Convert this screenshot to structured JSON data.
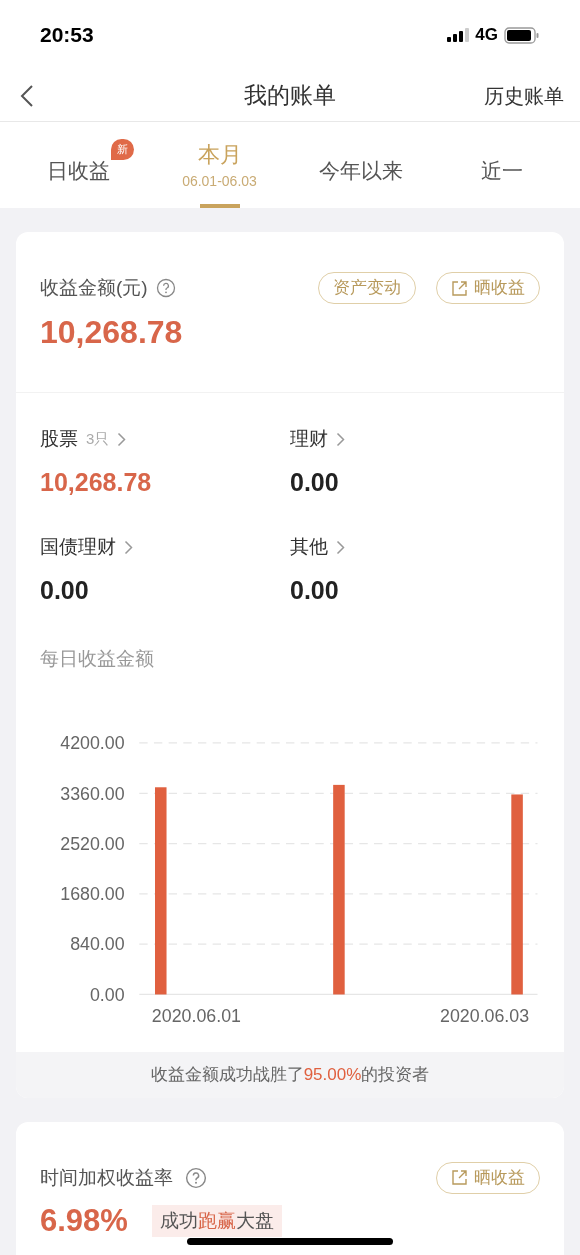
{
  "status_bar": {
    "time": "20:53",
    "network": "4G"
  },
  "nav": {
    "title": "我的账单",
    "action": "历史账单"
  },
  "tabs": [
    {
      "label": "日收益",
      "badge": "新",
      "selected": false
    },
    {
      "label": "本月",
      "sublabel": "06.01-06.03",
      "selected": true
    },
    {
      "label": "今年以来",
      "selected": false
    },
    {
      "label": "近一",
      "selected": false
    }
  ],
  "summary": {
    "label": "收益金额(元)",
    "amount": "10,268.78",
    "buttons": [
      {
        "label": "资产变动",
        "kind": "plain"
      },
      {
        "label": "晒收益",
        "kind": "share"
      }
    ]
  },
  "categories": [
    {
      "label": "股票",
      "count": "3只",
      "value": "10,268.78",
      "positive": true
    },
    {
      "label": "理财",
      "value": "0.00",
      "positive": false
    },
    {
      "label": "国债理财",
      "value": "0.00",
      "positive": false
    },
    {
      "label": "其他",
      "value": "0.00",
      "positive": false
    }
  ],
  "chart": {
    "title": "每日收益金额",
    "chart_data": {
      "type": "bar",
      "grid": true,
      "categories": [
        "2020.06.01",
        null,
        "2020.06.03"
      ],
      "series": [
        {
          "color": "#e0603f",
          "values": [
            3460,
            3500,
            3340
          ]
        }
      ],
      "ylim": [
        0,
        4200
      ],
      "yticks": [
        {
          "value": 0,
          "label": "0.00"
        },
        {
          "value": 840,
          "label": "840.00"
        },
        {
          "value": 1680,
          "label": "1680.00"
        },
        {
          "value": 2520,
          "label": "2520.00"
        },
        {
          "value": 3360,
          "label": "3360.00"
        },
        {
          "value": 4200,
          "label": "4200.00"
        }
      ]
    }
  },
  "beat": {
    "before": "收益金额成功战胜了",
    "highlight": "95.00%",
    "after": "的投资者"
  },
  "twr": {
    "label": "时间加权收益率",
    "value": "6.98%",
    "tag": {
      "before": "成功",
      "highlight": "跑赢",
      "after": "大盘"
    },
    "button": {
      "label": "晒收益",
      "kind": "share"
    }
  }
}
